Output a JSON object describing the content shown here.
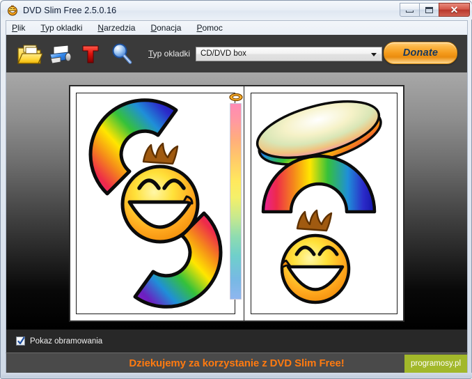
{
  "window": {
    "title": "DVD Slim Free 2.5.0.16",
    "title_icon": "smiley-app-icon",
    "controls": {
      "minimize": "minimize-icon",
      "maximize": "maximize-icon",
      "close": "✕"
    }
  },
  "menubar": {
    "items": [
      {
        "mnemonic": "P",
        "rest": "lik"
      },
      {
        "mnemonic": "T",
        "rest": "yp okladki"
      },
      {
        "mnemonic": "N",
        "rest": "arzedzia"
      },
      {
        "mnemonic": "D",
        "rest": "onacja"
      },
      {
        "mnemonic": "P",
        "rest": "omoc"
      }
    ]
  },
  "toolbar": {
    "icons": [
      {
        "name": "open-folder-icon",
        "tooltip": "Open"
      },
      {
        "name": "printer-icon",
        "tooltip": "Print"
      },
      {
        "name": "text-tool-icon",
        "tooltip": "Text"
      },
      {
        "name": "zoom-magnifier-icon",
        "tooltip": "Zoom"
      }
    ],
    "combo_label_mnemonic": "T",
    "combo_label_rest": "yp okladki",
    "combo_value": "CD/DVD box",
    "combo_options": [
      "CD/DVD box"
    ],
    "donate_label": "Donate"
  },
  "preview": {
    "cover_type": "CD/DVD box",
    "front_panel": "rainbow-g-smiley-artwork",
    "spine_panel": "rainbow-gradient-spine",
    "back_panel": "rainbow-ellipse-arch-smiley-artwork"
  },
  "options": {
    "show_borders_label": "Pokaz obramowania",
    "show_borders_checked": true
  },
  "statusbar": {
    "message": "Dziekujemy za korzystanie z DVD Slim Free!",
    "watermark": "programosy.pl"
  },
  "colors": {
    "accent_orange": "#ff7a10",
    "donate_orange": "#f49a1a",
    "watermark_green": "#a2b82a",
    "toolbar_dark": "#3a3a3a",
    "status_gray": "#4a4a4a"
  }
}
